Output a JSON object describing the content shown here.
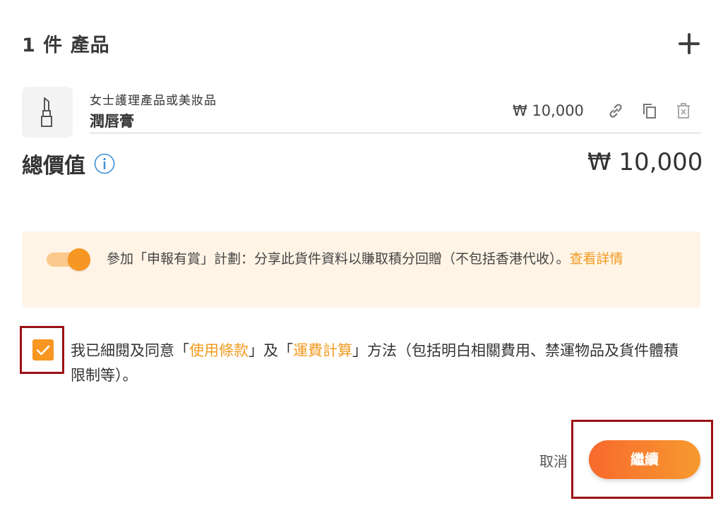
{
  "header": {
    "title": "1 件 產品",
    "add_icon": "plus-icon"
  },
  "product": {
    "thumbnail_icon": "lipstick-icon",
    "category": "女士護理產品或美妝品",
    "name": "潤唇膏",
    "price": "₩ 10,000",
    "actions": [
      "link-icon",
      "copy-icon",
      "delete-icon"
    ]
  },
  "total": {
    "label": "總價值",
    "info_icon": "info-icon",
    "value": "₩ 10,000"
  },
  "promo": {
    "toggle_on": true,
    "text": "參加「申報有賞」計劃：分享此貨件資料以賺取積分回贈（不包括香港代收）。",
    "link_text": "查看詳情"
  },
  "agreement": {
    "checked": true,
    "text_1": "我已細閱及同意「",
    "link_1": "使用條款",
    "text_2": "」及「",
    "link_2": "運費計算",
    "text_3": "」方法（包括明白相關費用、禁運物品及貨件體積限制等）。"
  },
  "footer": {
    "cancel_label": "取消",
    "continue_label": "繼續"
  },
  "colors": {
    "accent": "#f79621",
    "link": "#f29a1f",
    "promo_bg": "#fff4e6",
    "highlight": "#9b1013"
  }
}
